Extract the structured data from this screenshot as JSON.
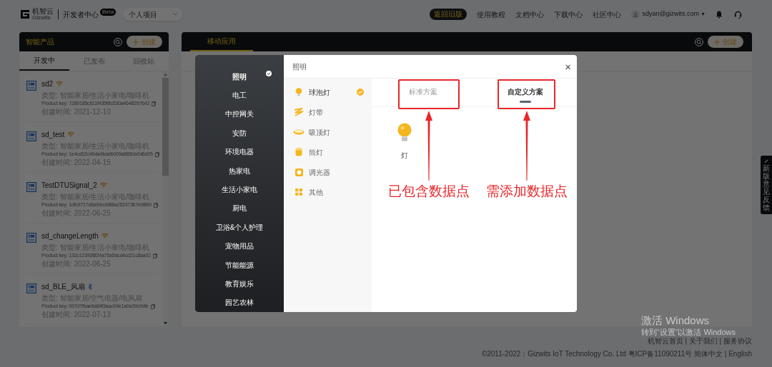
{
  "header": {
    "logo_text": "机智云",
    "logo_subtext": "Gizwits",
    "title": "开发者中心",
    "badge": "Beta",
    "project_select": "个人项目",
    "old_version_button": "返回旧版",
    "nav_links": [
      "使用教程",
      "文档中心",
      "下载中心",
      "社区中心"
    ],
    "user_email": "sdyan@gizwits.com",
    "user_caret": "▼"
  },
  "products_panel": {
    "title": "智能产品",
    "create_button": "创建",
    "tabs": [
      {
        "label": "开发中",
        "selected": true
      },
      {
        "label": "已发布",
        "selected": false
      },
      {
        "label": "回收站",
        "selected": false
      }
    ],
    "products": [
      {
        "name": "sd2",
        "kind": "wifi",
        "category": "类型: 智能家居/生活小家电/咖啡机",
        "product_key": "Product key: 7289185c611f435f8c530a4648297642",
        "created": "创建时间: 2021-12-10"
      },
      {
        "name": "sd_test",
        "kind": "wifi",
        "category": "类型: 智能家居/生活小家电/咖啡机",
        "product_key": "Product key: 1e4cd02c46da4badb009a885da0d6d05",
        "created": "创建时间: 2022-04-15"
      },
      {
        "name": "TestDTUSignal_2",
        "kind": "wifi",
        "category": "类型: 智能家居/生活小家电/咖啡机",
        "product_key": "Product key: 1dfc9717d6a94cd988a252473b7e9869",
        "created": "创建时间: 2022-06-25"
      },
      {
        "name": "sd_changeLength",
        "kind": "wifi",
        "category": "类型: 智能家居/生活小家电/咖啡机",
        "product_key": "Product key: 132c123928f24a75a5dcd4cd21c8aa02",
        "created": "创建时间: 2022-06-25"
      },
      {
        "name": "sd_BLE_风扇",
        "kind": "bluetooth",
        "category": "类型: 智能家居/空气电器/电风扇",
        "product_key": "Product key: 097d7fbae6a84f3aac04e1a0a39c9dfe",
        "created": "创建时间: 2022-07-13"
      }
    ]
  },
  "apps_panel": {
    "tabs": [
      {
        "label": "移动应用",
        "selected": true
      }
    ],
    "create_button": "创建"
  },
  "modal": {
    "title": "照明",
    "close": "×",
    "categories": [
      {
        "label": "照明",
        "selected": true
      },
      {
        "label": "电工",
        "selected": false
      },
      {
        "label": "中控网关",
        "selected": false
      },
      {
        "label": "安防",
        "selected": false
      },
      {
        "label": "环境电器",
        "selected": false
      },
      {
        "label": "热家电",
        "selected": false
      },
      {
        "label": "生活小家电",
        "selected": false
      },
      {
        "label": "厨电",
        "selected": false
      },
      {
        "label": "卫浴&个人护理",
        "selected": false
      },
      {
        "label": "宠物用品",
        "selected": false
      },
      {
        "label": "节能能源",
        "selected": false
      },
      {
        "label": "教育娱乐",
        "selected": false
      },
      {
        "label": "园艺农林",
        "selected": false
      }
    ],
    "subcategories": [
      {
        "label": "球泡灯",
        "kind": "bulb",
        "selected": true
      },
      {
        "label": "灯带",
        "kind": "strip",
        "selected": false
      },
      {
        "label": "吸顶灯",
        "kind": "ceiling",
        "selected": false
      },
      {
        "label": "筒灯",
        "kind": "downlight",
        "selected": false
      },
      {
        "label": "调光器",
        "kind": "dimmer",
        "selected": false
      },
      {
        "label": "其他",
        "kind": "grid",
        "selected": false
      }
    ],
    "scheme_tabs": [
      {
        "label": "标准方案",
        "selected": false
      },
      {
        "label": "自定义方案",
        "selected": true
      }
    ],
    "templates": [
      {
        "label": "灯"
      }
    ],
    "annotations": [
      {
        "text": "已包含数据点"
      },
      {
        "text": "需添加数据点"
      }
    ]
  },
  "feedback_tab": "新版意见反馈",
  "footer": {
    "links": "机智云首页 | 关于我们 | 服务协议",
    "copyright": "©2011-2022：Gizwits IoT Technology Co. Ltd 粤ICP备11090211号 简体中文 | English"
  },
  "os_notice": {
    "title": "激活 Windows",
    "subtitle": "转到“设置”以激活 Windows"
  }
}
